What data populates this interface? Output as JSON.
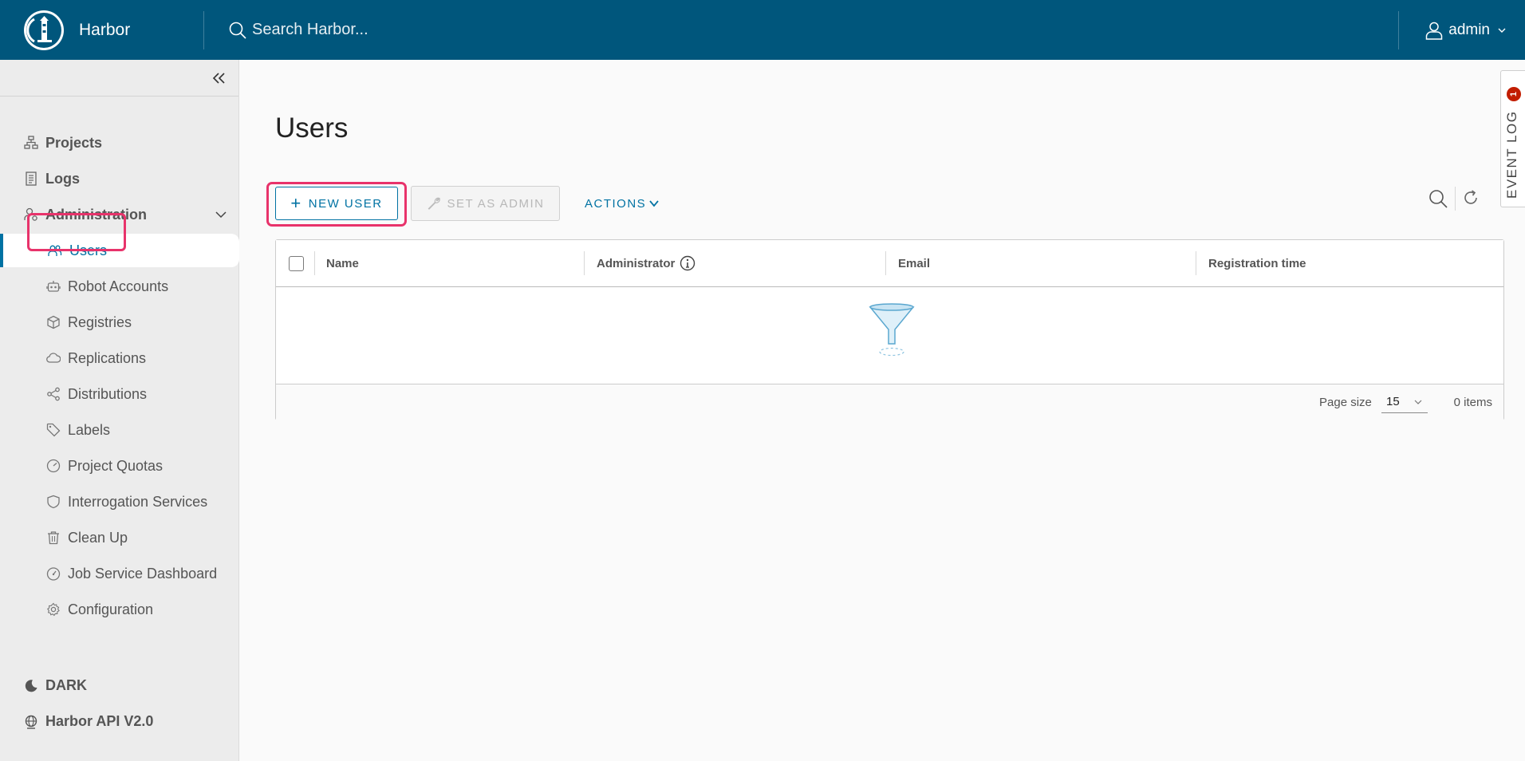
{
  "header": {
    "brand": "Harbor",
    "search_placeholder": "Search Harbor...",
    "user": "admin"
  },
  "sidebar": {
    "projects": "Projects",
    "logs": "Logs",
    "administration": "Administration",
    "admin_items": [
      {
        "label": "Users",
        "icon": "users-icon"
      },
      {
        "label": "Robot Accounts",
        "icon": "robot-icon"
      },
      {
        "label": "Registries",
        "icon": "box-icon"
      },
      {
        "label": "Replications",
        "icon": "cloud-sync-icon"
      },
      {
        "label": "Distributions",
        "icon": "share-icon"
      },
      {
        "label": "Labels",
        "icon": "tag-icon"
      },
      {
        "label": "Project Quotas",
        "icon": "gauge-icon"
      },
      {
        "label": "Interrogation Services",
        "icon": "shield-icon"
      },
      {
        "label": "Clean Up",
        "icon": "trash-icon"
      },
      {
        "label": "Job Service Dashboard",
        "icon": "dashboard-icon"
      },
      {
        "label": "Configuration",
        "icon": "gear-icon"
      }
    ],
    "active_item": "Users",
    "dark": "DARK",
    "api": "Harbor API V2.0"
  },
  "main": {
    "title": "Users",
    "new_user": "NEW USER",
    "set_as_admin": "SET AS ADMIN",
    "actions": "ACTIONS",
    "columns": [
      "Name",
      "Administrator",
      "Email",
      "Registration time"
    ],
    "page_size_label": "Page size",
    "page_size": "15",
    "items_count": "0 items"
  },
  "event_log": {
    "label": "EVENT LOG",
    "badge": "1"
  },
  "colors": {
    "header": "#00567c",
    "accent": "#0072a3",
    "highlight": "#e8336b",
    "badge": "#c21d00"
  }
}
